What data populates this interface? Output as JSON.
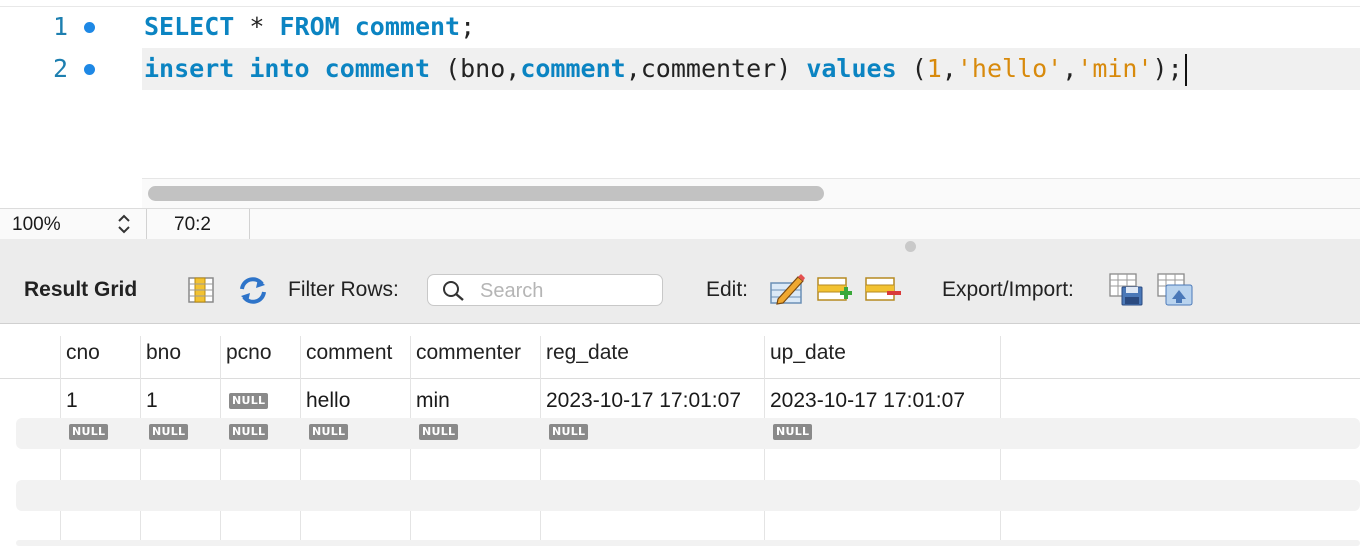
{
  "editor": {
    "lines": [
      {
        "number": "1",
        "tokens": [
          {
            "t": "SELECT",
            "c": "kw"
          },
          {
            "t": " * ",
            "c": ""
          },
          {
            "t": "FROM",
            "c": "kw"
          },
          {
            "t": " ",
            "c": ""
          },
          {
            "t": "comment",
            "c": "ident"
          },
          {
            "t": ";",
            "c": ""
          }
        ]
      },
      {
        "number": "2",
        "tokens": [
          {
            "t": "insert",
            "c": "kw"
          },
          {
            "t": " ",
            "c": ""
          },
          {
            "t": "into",
            "c": "kw"
          },
          {
            "t": " ",
            "c": ""
          },
          {
            "t": "comment",
            "c": "ident"
          },
          {
            "t": " (bno,",
            "c": ""
          },
          {
            "t": "comment",
            "c": "ident"
          },
          {
            "t": ",commenter) ",
            "c": ""
          },
          {
            "t": "values",
            "c": "kw"
          },
          {
            "t": " (",
            "c": ""
          },
          {
            "t": "1",
            "c": "num"
          },
          {
            "t": ",",
            "c": ""
          },
          {
            "t": "'hello'",
            "c": "str"
          },
          {
            "t": ",",
            "c": ""
          },
          {
            "t": "'min'",
            "c": "str"
          },
          {
            "t": ");",
            "c": ""
          }
        ]
      }
    ]
  },
  "status": {
    "zoom": "100%",
    "cursor_position": "70:2"
  },
  "toolbar": {
    "result_grid_label": "Result Grid",
    "filter_rows_label": "Filter Rows:",
    "search_placeholder": "Search",
    "edit_label": "Edit:",
    "export_import_label": "Export/Import:"
  },
  "grid": {
    "columns": [
      "cno",
      "bno",
      "pcno",
      "comment",
      "commenter",
      "reg_date",
      "up_date"
    ],
    "rows": [
      [
        "1",
        "1",
        null,
        "hello",
        "min",
        "2023-10-17 17:01:07",
        "2023-10-17 17:01:07"
      ],
      [
        null,
        null,
        null,
        null,
        null,
        null,
        null
      ]
    ],
    "null_label": "NULL"
  },
  "colors": {
    "keyword": "#0b84c2",
    "string": "#d88a0c",
    "line_number": "#1d7fb0",
    "breakpoint": "#1e88e5",
    "null_badge": "#8a8a8a"
  }
}
